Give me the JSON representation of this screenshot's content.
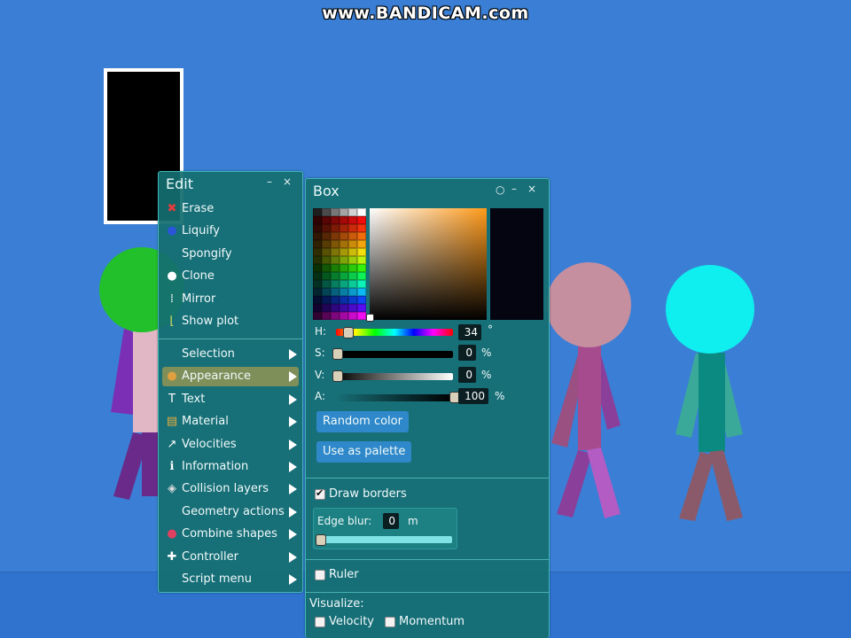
{
  "watermark": "www.BANDICAM.com",
  "edit_menu": {
    "title": "Edit",
    "minimize": "–",
    "close": "×",
    "items": [
      {
        "label": "Erase",
        "icon": "erase-icon",
        "glyph": "✖",
        "color": "#e83a3a"
      },
      {
        "label": "Liquify",
        "icon": "liquify-icon",
        "glyph": "●",
        "color": "#2a55d8"
      },
      {
        "label": "Spongify",
        "icon": "",
        "glyph": "",
        "color": ""
      },
      {
        "label": "Clone",
        "icon": "clone-icon",
        "glyph": "●",
        "color": "#ffffff"
      },
      {
        "label": "Mirror",
        "icon": "mirror-icon",
        "glyph": "⁞",
        "color": "#ffffff"
      },
      {
        "label": "Show plot",
        "icon": "plot-icon",
        "glyph": "⌊",
        "color": "#d8e060"
      }
    ],
    "submenus": [
      {
        "label": "Selection",
        "icon": "",
        "glyph": "",
        "color": ""
      },
      {
        "label": "Appearance",
        "icon": "palette-icon",
        "glyph": "●",
        "color": "#e0a040"
      },
      {
        "label": "Text",
        "icon": "text-icon",
        "glyph": "T",
        "color": "#ffffff"
      },
      {
        "label": "Material",
        "icon": "material-icon",
        "glyph": "▤",
        "color": "#e8b040"
      },
      {
        "label": "Velocities",
        "icon": "velocities-icon",
        "glyph": "↗",
        "color": "#ffffff"
      },
      {
        "label": "Information",
        "icon": "information-icon",
        "glyph": "ℹ",
        "color": "#ffffff"
      },
      {
        "label": "Collision layers",
        "icon": "layers-icon",
        "glyph": "◈",
        "color": "#dddddd"
      },
      {
        "label": "Geometry actions",
        "icon": "",
        "glyph": "",
        "color": ""
      },
      {
        "label": "Combine shapes",
        "icon": "combine-icon",
        "glyph": "●",
        "color": "#e04060"
      },
      {
        "label": "Controller",
        "icon": "controller-icon",
        "glyph": "✚",
        "color": "#ffffff"
      },
      {
        "label": "Script menu",
        "icon": "",
        "glyph": "",
        "color": ""
      }
    ],
    "active_item": "Appearance"
  },
  "box_panel": {
    "title": "Box",
    "pin": "○",
    "minimize": "–",
    "close": "×",
    "hue": {
      "label": "H:",
      "value": "34",
      "unit": "°",
      "fraction": 0.094
    },
    "saturation": {
      "label": "S:",
      "value": "0",
      "unit": "%",
      "fraction": 0
    },
    "value": {
      "label": "V:",
      "value": "0",
      "unit": "%",
      "fraction": 0
    },
    "alpha": {
      "label": "A:",
      "value": "100",
      "unit": "%",
      "fraction": 1
    },
    "random_color_button": "Random color",
    "use_as_palette_button": "Use as palette",
    "draw_borders": {
      "label": "Draw borders",
      "checked": true
    },
    "edge_blur": {
      "label": "Edge blur:",
      "value": "0",
      "unit": "m",
      "fraction": 0
    },
    "ruler": {
      "label": "Ruler",
      "checked": false
    },
    "visualize_label": "Visualize:",
    "velocity": {
      "label": "Velocity",
      "checked": false
    },
    "momentum": {
      "label": "Momentum",
      "checked": false
    }
  },
  "colors": {
    "background": "#3a7fd5",
    "panel": "#146e70",
    "accent_button": "#2f88c9",
    "selected_color": "#050512"
  }
}
